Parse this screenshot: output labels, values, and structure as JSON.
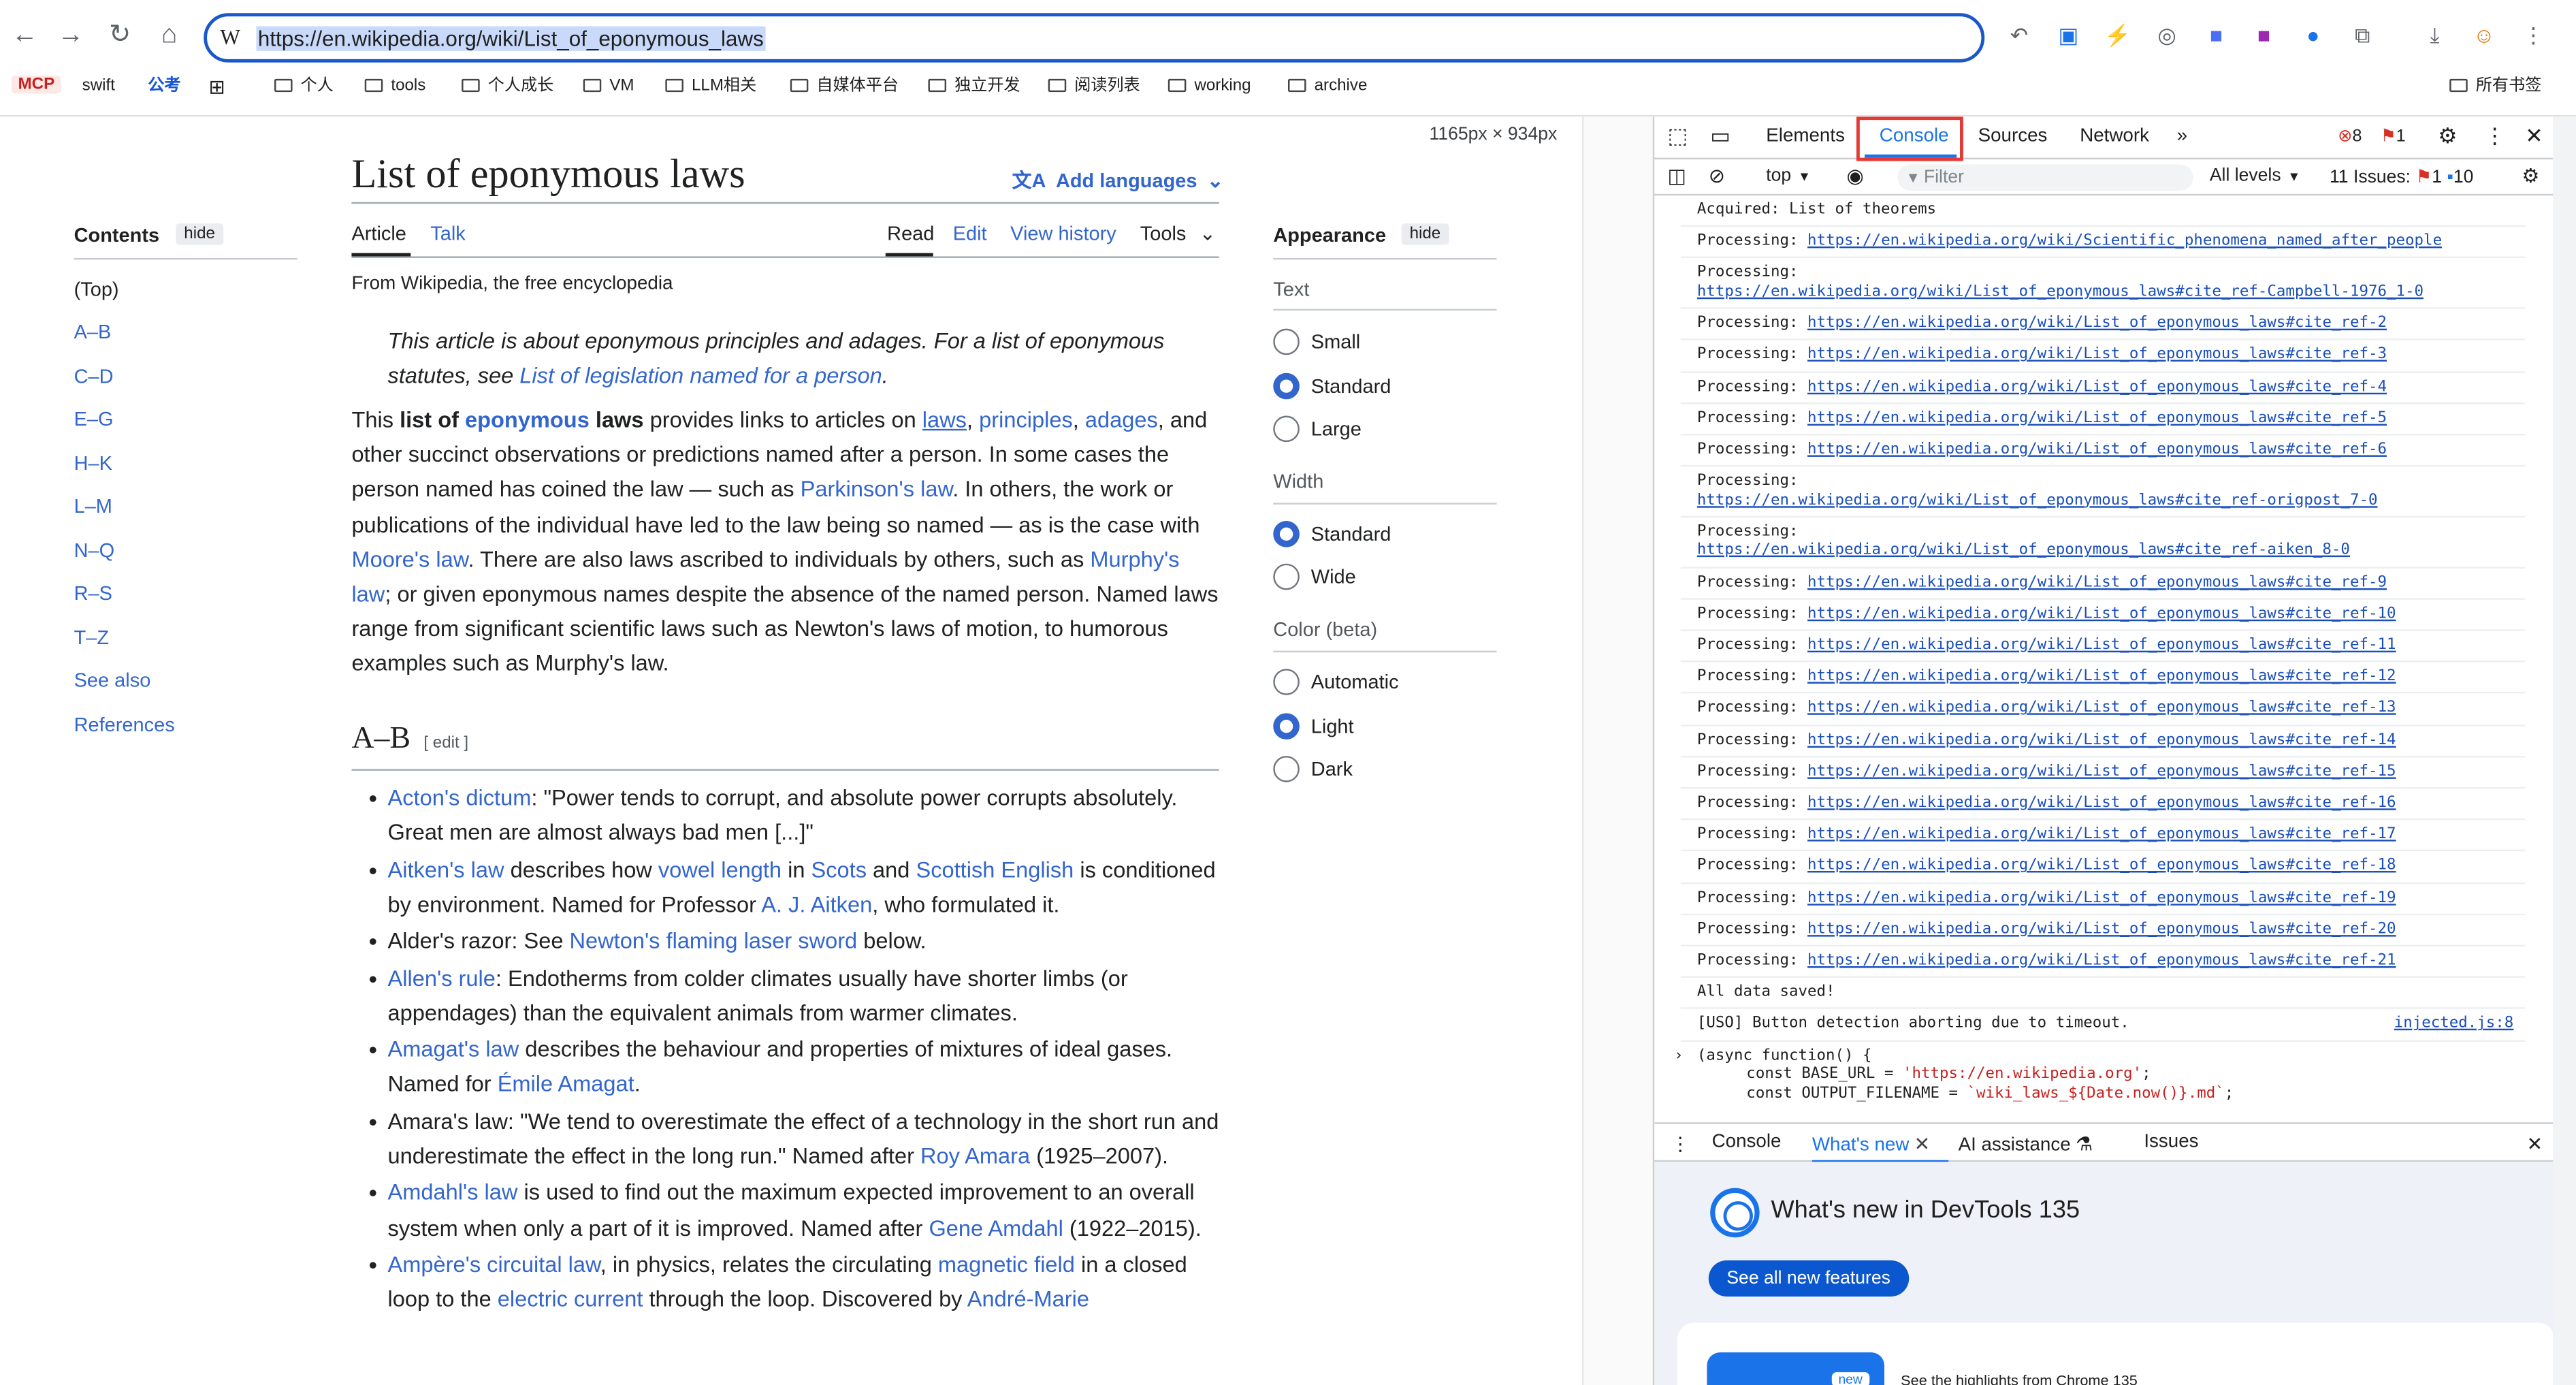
{
  "browser": {
    "url": "https://en.wikipedia.org/wiki/List_of_eponymous_laws",
    "site_icon": "W",
    "bookmarks": {
      "mcp": "MCP",
      "swift": "swift",
      "gongkao": "公考",
      "folders": [
        "个人",
        "tools",
        "个人成长",
        "VM",
        "LLM相关",
        "自媒体平台",
        "独立开发",
        "阅读列表",
        "working",
        "archive"
      ],
      "all_bookmarks": "所有书签"
    }
  },
  "viewport_label": "1165px × 934px",
  "wiki": {
    "contents_title": "Contents",
    "hide": "hide",
    "toc": [
      "(Top)",
      "A–B",
      "C–D",
      "E–G",
      "H–K",
      "L–M",
      "N–Q",
      "R–S",
      "T–Z",
      "See also",
      "References"
    ],
    "title": "List of eponymous laws",
    "add_languages": "Add languages",
    "tabs": {
      "article": "Article",
      "talk": "Talk",
      "read": "Read",
      "edit": "Edit",
      "view_history": "View history",
      "tools": "Tools"
    },
    "from": "From Wikipedia, the free encyclopedia",
    "hatnote_a": "This article is about eponymous principles and adages. For a list of eponymous statutes, see ",
    "hatnote_link": "List of legislation named for a person",
    "hatnote_b": ".",
    "lead": {
      "p1": "This ",
      "b1": "list of ",
      "l1": "eponymous",
      "b2": " laws",
      "p2": " provides links to articles on ",
      "l2": "laws",
      "p3": ", ",
      "l3": "principles",
      "p4": ", ",
      "l4": "adages",
      "p5": ", and other succinct observations or predictions named after a person. In some cases the person named has coined the law — such as ",
      "l5": "Parkinson's law",
      "p6": ". In others, the work or publications of the individual have led to the law being so named — as is the case with ",
      "l6": "Moore's law",
      "p7": ". There are also laws ascribed to individuals by others, such as ",
      "l7": "Murphy's law",
      "p8": "; or given eponymous names despite the absence of the named person. Named laws range from significant scientific laws such as Newton's laws of motion, to humorous examples such as Murphy's law."
    },
    "section_heading": "A–B",
    "section_edit": "[ edit ]",
    "items": [
      {
        "l1": "Acton's dictum",
        "t1": ": \"Power tends to corrupt, and absolute power corrupts absolutely. Great men are almost always bad men [...]\""
      },
      {
        "l1": "Aitken's law",
        "t1": " describes how ",
        "l2": "vowel length",
        "t2": " in ",
        "l3": "Scots",
        "t3": " and ",
        "l4": "Scottish English",
        "t4": " is conditioned by environment. Named for Professor ",
        "l5": "A. J. Aitken",
        "t5": ", who formulated it."
      },
      {
        "t0": "Alder's razor: See ",
        "l1": "Newton's flaming laser sword",
        "t1": " below."
      },
      {
        "l1": "Allen's rule",
        "t1": ": Endotherms from colder climates usually have shorter limbs (or appendages) than the equivalent animals from warmer climates."
      },
      {
        "l1": "Amagat's law",
        "t1": " describes the behaviour and properties of mixtures of ideal gases. Named for ",
        "l2": "Émile Amagat",
        "t2": "."
      },
      {
        "t0": "Amara's law: \"We tend to overestimate the effect of a technology in the short run and underestimate the effect in the long run.\" Named after ",
        "l1": "Roy Amara",
        "t1": " (1925–2007)."
      },
      {
        "l1": "Amdahl's law",
        "t1": " is used to find out the maximum expected improvement to an overall system when only a part of it is improved. Named after ",
        "l2": "Gene Amdahl",
        "t2": " (1922–2015)."
      },
      {
        "l1": "Ampère's circuital law",
        "t1": ", in physics, relates the circulating ",
        "l2": "magnetic field",
        "t2": " in a closed loop to the ",
        "l3": "electric current",
        "t3": " through the loop. Discovered by ",
        "l4": "André-Marie",
        "t4": ""
      }
    ],
    "appearance": {
      "title": "Appearance",
      "hide": "hide",
      "text_label": "Text",
      "text_options": [
        "Small",
        "Standard",
        "Large"
      ],
      "width_label": "Width",
      "width_options": [
        "Standard",
        "Wide"
      ],
      "color_label": "Color (beta)",
      "color_options": [
        "Automatic",
        "Light",
        "Dark"
      ],
      "selected": {
        "text": "Standard",
        "width": "Standard",
        "color": "Light"
      }
    }
  },
  "devtools": {
    "tabs": [
      "Elements",
      "Console",
      "Sources",
      "Network"
    ],
    "error_count": "8",
    "warning_count": "1",
    "context": "top",
    "filter_placeholder": "Filter",
    "levels": "All levels",
    "issues_label": "11 Issues:",
    "issues_errors": "1",
    "issues_info": "10",
    "log": {
      "acquired": "Acquired: List of theorems",
      "prefix": "Processing:",
      "lines": [
        {
          "url": "https://en.wikipedia.org/wiki/Scientific_phenomena_named_after_people",
          "wrap": false
        },
        {
          "url": "https://en.wikipedia.org/wiki/List_of_eponymous_laws#cite_ref-Campbell-1976_1-0",
          "wrap": true
        },
        {
          "url": "https://en.wikipedia.org/wiki/List_of_eponymous_laws#cite_ref-2",
          "wrap": false
        },
        {
          "url": "https://en.wikipedia.org/wiki/List_of_eponymous_laws#cite_ref-3",
          "wrap": false
        },
        {
          "url": "https://en.wikipedia.org/wiki/List_of_eponymous_laws#cite_ref-4",
          "wrap": false
        },
        {
          "url": "https://en.wikipedia.org/wiki/List_of_eponymous_laws#cite_ref-5",
          "wrap": false
        },
        {
          "url": "https://en.wikipedia.org/wiki/List_of_eponymous_laws#cite_ref-6",
          "wrap": false
        },
        {
          "url": "https://en.wikipedia.org/wiki/List_of_eponymous_laws#cite_ref-origpost_7-0",
          "wrap": true
        },
        {
          "url": "https://en.wikipedia.org/wiki/List_of_eponymous_laws#cite_ref-aiken_8-0",
          "wrap": true
        },
        {
          "url": "https://en.wikipedia.org/wiki/List_of_eponymous_laws#cite_ref-9",
          "wrap": false
        },
        {
          "url": "https://en.wikipedia.org/wiki/List_of_eponymous_laws#cite_ref-10",
          "wrap": false
        },
        {
          "url": "https://en.wikipedia.org/wiki/List_of_eponymous_laws#cite_ref-11",
          "wrap": false
        },
        {
          "url": "https://en.wikipedia.org/wiki/List_of_eponymous_laws#cite_ref-12",
          "wrap": false
        },
        {
          "url": "https://en.wikipedia.org/wiki/List_of_eponymous_laws#cite_ref-13",
          "wrap": false
        },
        {
          "url": "https://en.wikipedia.org/wiki/List_of_eponymous_laws#cite_ref-14",
          "wrap": false
        },
        {
          "url": "https://en.wikipedia.org/wiki/List_of_eponymous_laws#cite_ref-15",
          "wrap": false
        },
        {
          "url": "https://en.wikipedia.org/wiki/List_of_eponymous_laws#cite_ref-16",
          "wrap": false
        },
        {
          "url": "https://en.wikipedia.org/wiki/List_of_eponymous_laws#cite_ref-17",
          "wrap": false
        },
        {
          "url": "https://en.wikipedia.org/wiki/List_of_eponymous_laws#cite_ref-18",
          "wrap": false
        },
        {
          "url": "https://en.wikipedia.org/wiki/List_of_eponymous_laws#cite_ref-19",
          "wrap": false
        },
        {
          "url": "https://en.wikipedia.org/wiki/List_of_eponymous_laws#cite_ref-20",
          "wrap": false
        },
        {
          "url": "https://en.wikipedia.org/wiki/List_of_eponymous_laws#cite_ref-21",
          "wrap": false
        }
      ],
      "saved": "All data saved!",
      "uso": "[USO] Button detection aborting due to timeout.",
      "uso_source": "injected.js:8",
      "code_1": "(async function() {",
      "code_2_a": "const BASE_URL = ",
      "code_2_b": "'https://en.wikipedia.org'",
      "code_2_c": ";",
      "code_3_a": "const OUTPUT_FILENAME = ",
      "code_3_b": "`wiki_laws_${Date.now()}.md`",
      "code_3_c": ";"
    },
    "drawer_tabs": {
      "console": "Console",
      "whats_new": "What's new",
      "ai": "AI assistance",
      "issues": "Issues"
    },
    "whats_new_title": "What's new in DevTools 135",
    "see_all": "See all new features",
    "card_badge": "new",
    "card_text": "See the highlights from Chrome 135"
  },
  "colors": {
    "accent": "#1a73e8",
    "link": "#3366cc",
    "highlight_box": "#e53935"
  }
}
